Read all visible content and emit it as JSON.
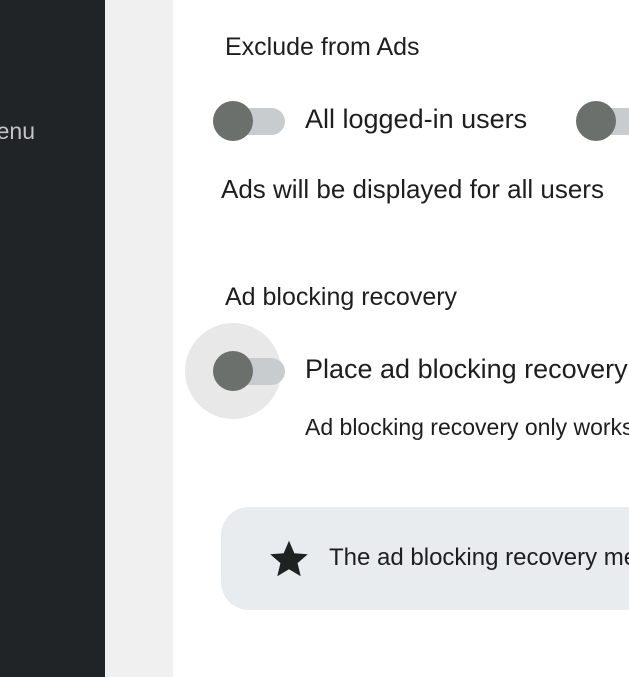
{
  "sidebar": {
    "menu_label": "enu"
  },
  "exclude_ads": {
    "heading": "Exclude from Ads",
    "toggle_all_logged_in": {
      "label": "All logged-in users",
      "checked": false
    },
    "toggle_second": {
      "checked": false
    },
    "help_text": "Ads will be displayed for all users"
  },
  "ad_blocking": {
    "heading": "Ad blocking recovery",
    "toggle": {
      "label": "Place ad blocking recovery",
      "checked": false
    },
    "help_text": "Ad blocking recovery only works"
  },
  "notice": {
    "icon": "star-icon",
    "text": "The ad blocking recovery message"
  },
  "colors": {
    "sidebar_bg": "#202427",
    "toggle_thumb": "#6c706d",
    "toggle_track": "#c9cccf",
    "notice_bg": "#e9ecef"
  }
}
